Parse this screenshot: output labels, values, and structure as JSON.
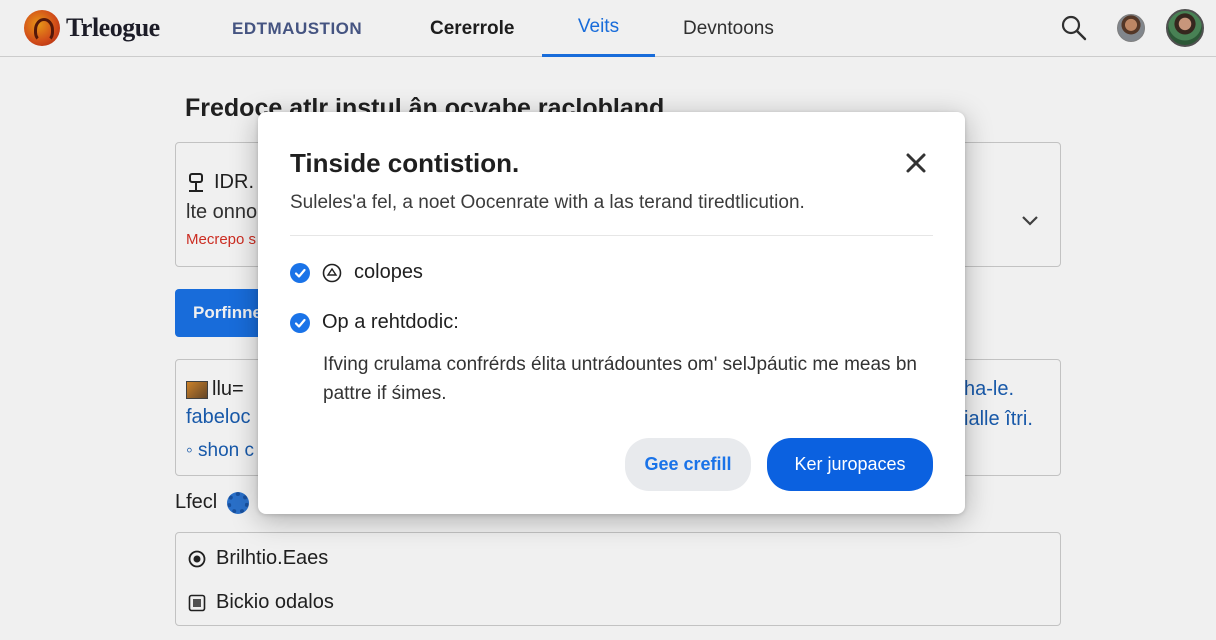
{
  "app": {
    "logo_text": "Trleogue"
  },
  "nav": {
    "tabs": [
      {
        "label": "EDTMAUSTION",
        "active": false
      },
      {
        "label": "Cererrole",
        "active": false
      },
      {
        "label": "Veits",
        "active": true
      },
      {
        "label": "Devntoons",
        "active": false
      }
    ],
    "search_icon": "search-icon",
    "avatars": [
      "user-avatar-small",
      "user-avatar-profile"
    ]
  },
  "background": {
    "page_title": "Fredoce atlr instul ân ocvabe raclobland",
    "card1": {
      "line1": "IDR.",
      "line2": "lte onno",
      "line3": "Mecrepo s"
    },
    "primary_button": "Porfinne",
    "card2": {
      "line1": "llu=",
      "line2": "fabeloc",
      "line3": "◦ shon c",
      "right1": "ha-le.",
      "right2": "ialle îtri."
    },
    "section_label": "Lfecl",
    "list": [
      {
        "icon": "radio-icon",
        "label": "Brilhtio.Eaes"
      },
      {
        "icon": "image-icon",
        "label": "Bickio odalos"
      }
    ]
  },
  "modal": {
    "title": "Tinside contistion.",
    "description": "Suleles'a fel, a noet Oocenrate with a las terand tiredtlicution.",
    "options": [
      {
        "label": "colopes",
        "checked": true,
        "icon": "badge-icon"
      },
      {
        "label": "Op a rehtdodic:",
        "checked": true
      }
    ],
    "option_body": "Ifving crulama confrérds élita untrádountes om' selJpáutic me meas bn pattre if śimes.",
    "secondary_button": "Gee crefill",
    "primary_button": "Ker juropaces"
  },
  "colors": {
    "accent": "#1a73e8",
    "primary_button": "#0b61e0",
    "error": "#d93025",
    "link": "#1a5fb4"
  }
}
